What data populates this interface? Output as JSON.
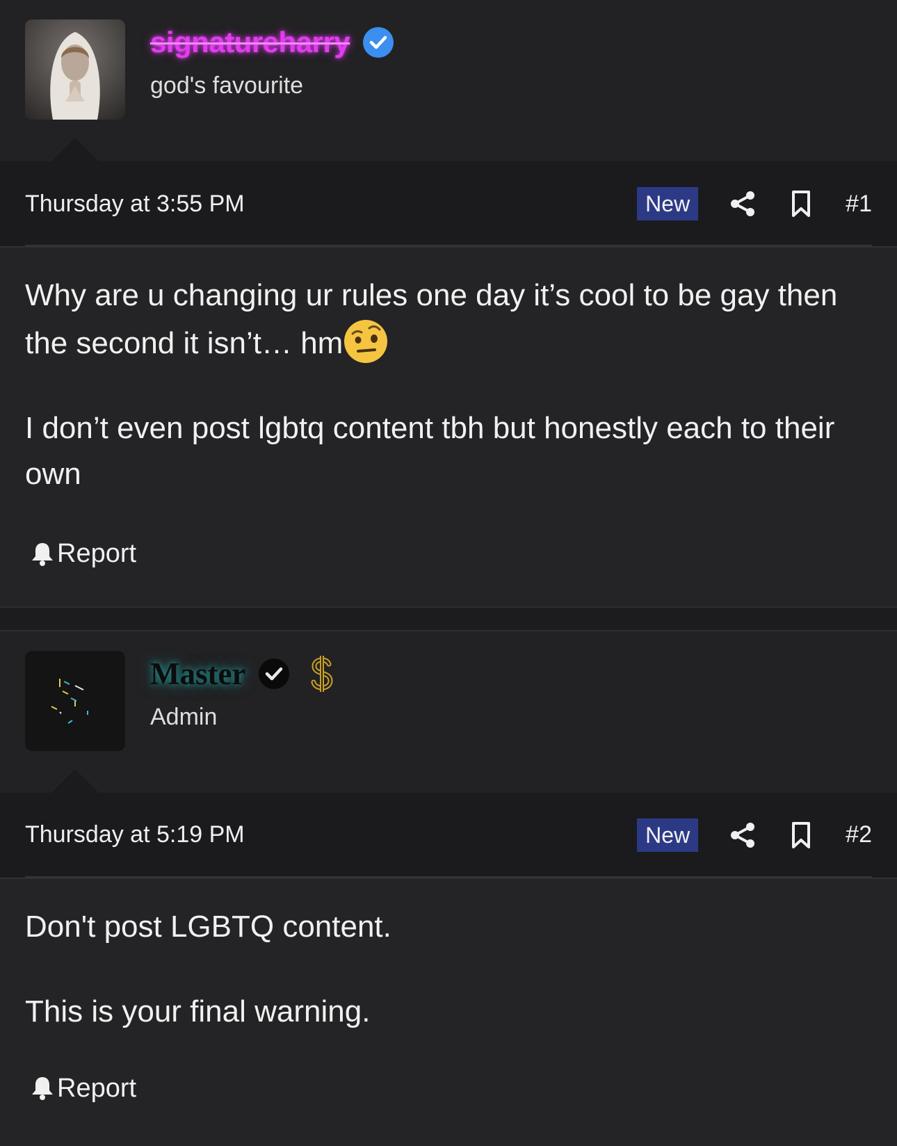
{
  "posts": [
    {
      "username": "signatureharry",
      "user_title": "god's favourite",
      "date": "Thursday at 3:55 PM",
      "badge": "New",
      "post_number": "#1",
      "paragraphs": [
        "Why are u changing ur rules one day it’s cool to be gay then the second it isn’t… hm",
        "I don’t even post lgbtq content tbh but honestly each to their own"
      ],
      "report_label": "Report"
    },
    {
      "username": "Master",
      "user_title": "Admin",
      "date": "Thursday at 5:19 PM",
      "badge": "New",
      "post_number": "#2",
      "paragraphs": [
        "Don't post LGBTQ content.",
        "This is your final warning."
      ],
      "report_label": "Report"
    }
  ],
  "icons": {
    "verified": "verified-check-icon",
    "dollar": "dollar-sign-icon",
    "share": "share-icon",
    "bookmark": "bookmark-icon",
    "report": "bell-icon",
    "emoji": "face-with-raised-eyebrow-emoji"
  },
  "colors": {
    "username_1": "#e23df0",
    "username_2_glow": "#28aaaa",
    "badge_bg": "#2c3a86",
    "verified_blue": "#3b8ff0"
  }
}
